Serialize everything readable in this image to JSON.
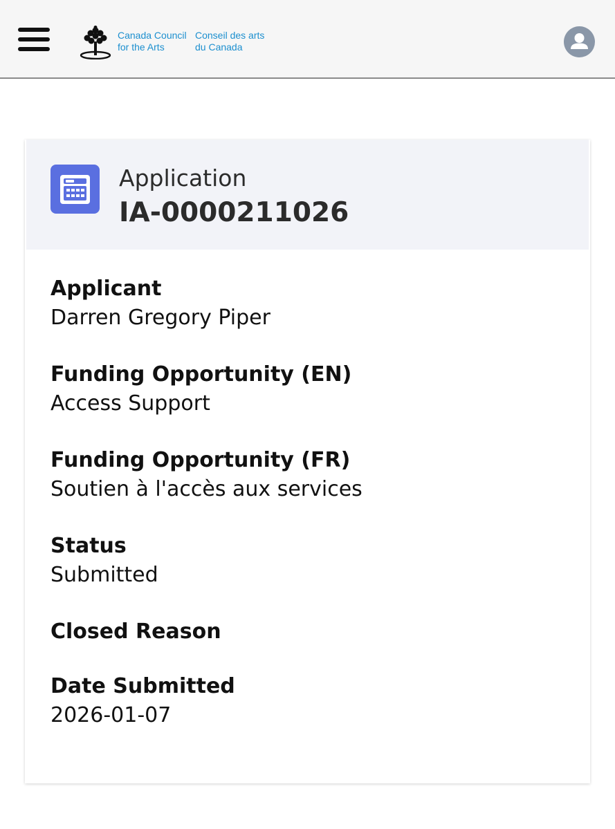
{
  "header": {
    "logo": {
      "en_line1": "Canada Council",
      "en_line2": "for the Arts",
      "fr_line1": "Conseil des arts",
      "fr_line2": "du Canada",
      "brand_color": "#1c8fcf"
    },
    "menu_icon": "hamburger-menu-icon",
    "avatar_icon": "user-avatar-icon"
  },
  "record": {
    "type": "Application",
    "id": "IA-0000211026",
    "icon": "calendar-form-icon",
    "icon_color": "#5a6fe0"
  },
  "fields": {
    "applicant": {
      "label": "Applicant",
      "value": "Darren Gregory Piper"
    },
    "funding_en": {
      "label": "Funding Opportunity (EN)",
      "value": "Access Support"
    },
    "funding_fr": {
      "label": "Funding Opportunity (FR)",
      "value": "Soutien à l'accès aux services"
    },
    "status": {
      "label": "Status",
      "value": "Submitted"
    },
    "closed_reason": {
      "label": "Closed Reason",
      "value": ""
    },
    "date_submitted": {
      "label": "Date Submitted",
      "value": "2026-01-07"
    }
  }
}
